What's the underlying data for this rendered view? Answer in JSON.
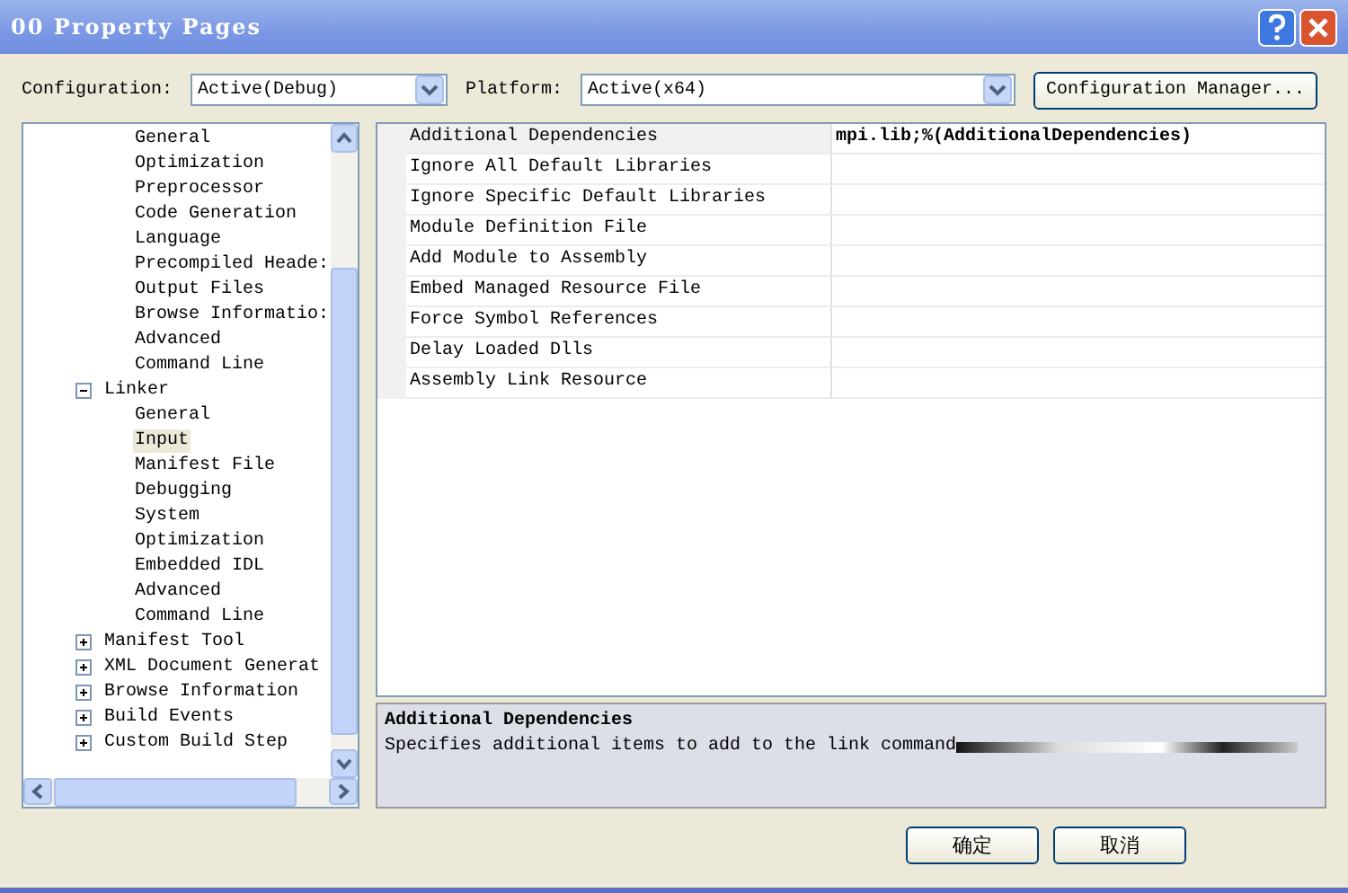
{
  "window": {
    "title": "00 Property Pages"
  },
  "configuration": {
    "label": "Configuration:",
    "value": "Active(Debug)"
  },
  "platform": {
    "label": "Platform:",
    "value": "Active(x64)"
  },
  "configuration_manager": {
    "label": "Configuration Manager..."
  },
  "tree": {
    "items": [
      {
        "children": [
          {
            "label": "General",
            "selected": false
          },
          {
            "label": "Optimization",
            "selected": false
          },
          {
            "label": "Preprocessor",
            "selected": false
          },
          {
            "label": "Code Generation",
            "selected": false
          },
          {
            "label": "Language",
            "selected": false
          },
          {
            "label": "Precompiled Heade:",
            "selected": false
          },
          {
            "label": "Output Files",
            "selected": false
          },
          {
            "label": "Browse Informatio:",
            "selected": false
          },
          {
            "label": "Advanced",
            "selected": false
          },
          {
            "label": "Command Line",
            "selected": false
          }
        ]
      },
      {
        "label": "Linker",
        "expanded": true,
        "selected": false,
        "children": [
          {
            "label": "General",
            "selected": false
          },
          {
            "label": "Input",
            "selected": true
          },
          {
            "label": "Manifest File",
            "selected": false
          },
          {
            "label": "Debugging",
            "selected": false
          },
          {
            "label": "System",
            "selected": false
          },
          {
            "label": "Optimization",
            "selected": false
          },
          {
            "label": "Embedded IDL",
            "selected": false
          },
          {
            "label": "Advanced",
            "selected": false
          },
          {
            "label": "Command Line",
            "selected": false
          }
        ]
      },
      {
        "label": "Manifest Tool",
        "expanded": false,
        "selected": false
      },
      {
        "label": "XML Document Generat",
        "expanded": false,
        "selected": false
      },
      {
        "label": "Browse Information",
        "expanded": false,
        "selected": false
      },
      {
        "label": "Build Events",
        "expanded": false,
        "selected": false
      },
      {
        "label": "Custom Build Step",
        "expanded": false,
        "selected": false
      }
    ]
  },
  "properties": [
    {
      "name": "Additional Dependencies",
      "value": "mpi.lib;%(AdditionalDependencies)",
      "selected": true
    },
    {
      "name": "Ignore All Default Libraries",
      "selected": false
    },
    {
      "name": "Ignore Specific Default Libraries",
      "selected": false
    },
    {
      "name": "Module Definition File",
      "selected": false
    },
    {
      "name": "Add Module to Assembly",
      "selected": false
    },
    {
      "name": "Embed Managed Resource File",
      "selected": false
    },
    {
      "name": "Force Symbol References",
      "selected": false
    },
    {
      "name": "Delay Loaded Dlls",
      "selected": false
    },
    {
      "name": "Assembly Link Resource",
      "selected": false
    }
  ],
  "description": {
    "title": "Additional Dependencies",
    "text": "Specifies additional items to add to the link command"
  },
  "buttons": [
    {
      "label": "确定"
    },
    {
      "label": "取消"
    }
  ]
}
